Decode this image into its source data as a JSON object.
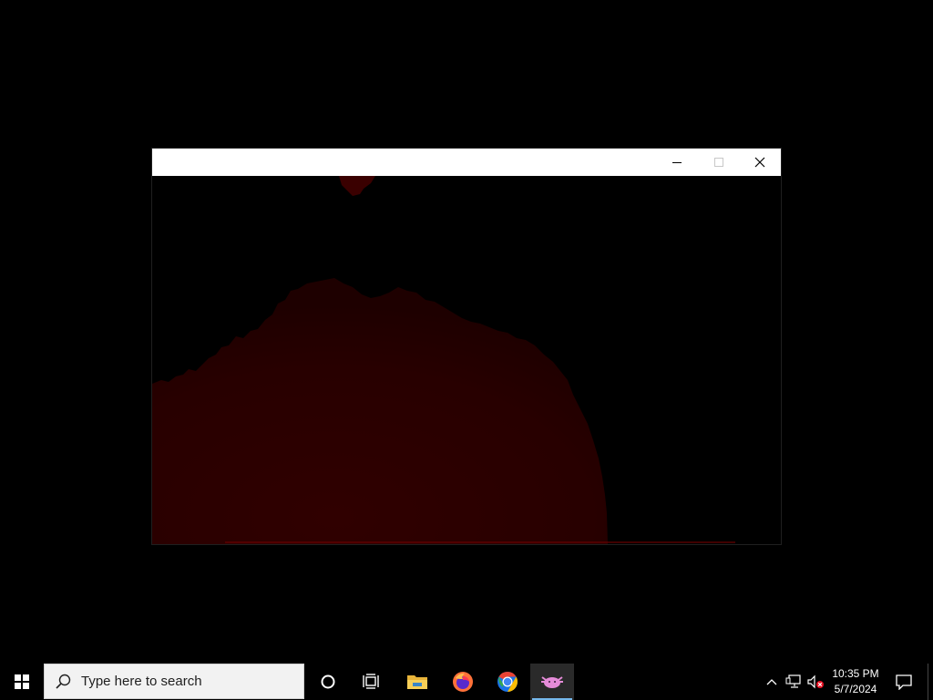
{
  "window": {
    "title": "",
    "caption_buttons": {
      "minimize": "minimize",
      "maximize": "maximize",
      "close": "close"
    },
    "render_color": "#2a0000",
    "highlight_color": "#6b0000"
  },
  "taskbar": {
    "search": {
      "placeholder": "Type here to search"
    },
    "pinned_apps": [
      {
        "name": "cortana-icon"
      },
      {
        "name": "task-view-icon"
      },
      {
        "name": "file-explorer-icon"
      },
      {
        "name": "firefox-icon"
      },
      {
        "name": "chrome-icon"
      },
      {
        "name": "axolotl-app-icon",
        "active": true
      }
    ],
    "accent_color": "#76b9ed",
    "tray": {
      "clock_time": "10:35 PM",
      "clock_date": "5/7/2024"
    }
  }
}
